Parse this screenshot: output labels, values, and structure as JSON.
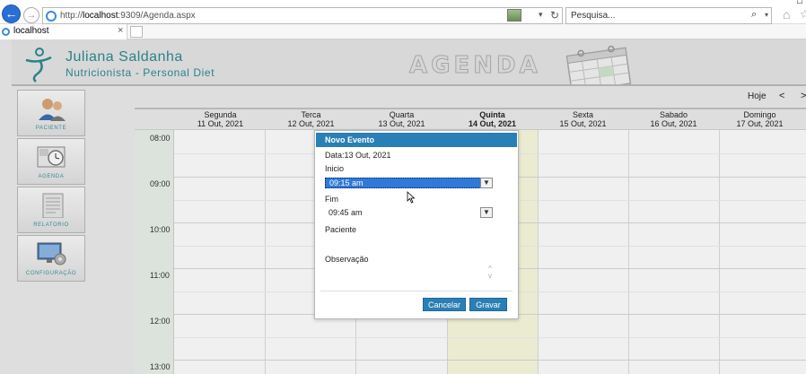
{
  "browser": {
    "url_prefix": "http://",
    "url_host": "localhost",
    "url_rest": ":9309/Agenda.aspx",
    "search_placeholder": "Pesquisa...",
    "tab_title": "localhost",
    "tab_close": "×",
    "back_glyph": "←",
    "forward_glyph": "→",
    "refresh_glyph": "↻",
    "drop_glyph": "▾",
    "search_glyph": "⌕",
    "home_glyph": "⌂",
    "star_glyph": "☆",
    "window_glyph": "□"
  },
  "header": {
    "brand_name": "Juliana Saldanha",
    "brand_sub": "Nutricionista - Personal Diet",
    "section_title": "AGENDA",
    "brand_color": "#2f8a92"
  },
  "sidebar": {
    "items": [
      {
        "label": "PACIENTE",
        "icon": "patients-icon"
      },
      {
        "label": "AGENDA",
        "icon": "clock-icon"
      },
      {
        "label": "RELATORIO",
        "icon": "report-icon"
      },
      {
        "label": "CONFIGURAÇÃO",
        "icon": "settings-icon"
      }
    ]
  },
  "calendar": {
    "today_label": "Hoje",
    "prev_label": "<",
    "next_label": ">",
    "days": [
      {
        "name": "Segunda",
        "date": "11 Out, 2021"
      },
      {
        "name": "Terca",
        "date": "12 Out, 2021"
      },
      {
        "name": "Quarta",
        "date": "13 Out, 2021"
      },
      {
        "name": "Quinta",
        "date": "14 Out, 2021"
      },
      {
        "name": "Sexta",
        "date": "15 Out, 2021"
      },
      {
        "name": "Sabado",
        "date": "16 Out, 2021"
      },
      {
        "name": "Domingo",
        "date": "17 Out, 2021"
      }
    ],
    "hours": [
      "08:00",
      "09:00",
      "10:00",
      "11:00",
      "12:00",
      "13:00"
    ]
  },
  "modal": {
    "title": "Novo Evento",
    "date_text": "Data:13 Out, 2021",
    "start_label": "Inicio",
    "start_value": "09:15 am",
    "end_label": "Fim",
    "end_value": "09:45 am",
    "patient_label": "Paciente",
    "notes_label": "Observação",
    "cancel_label": "Cancelar",
    "save_label": "Gravar",
    "caret_glyph": "▼",
    "scroll_up_glyph": "^",
    "scroll_down_glyph": "v",
    "accent_color": "#2a7fb6"
  }
}
